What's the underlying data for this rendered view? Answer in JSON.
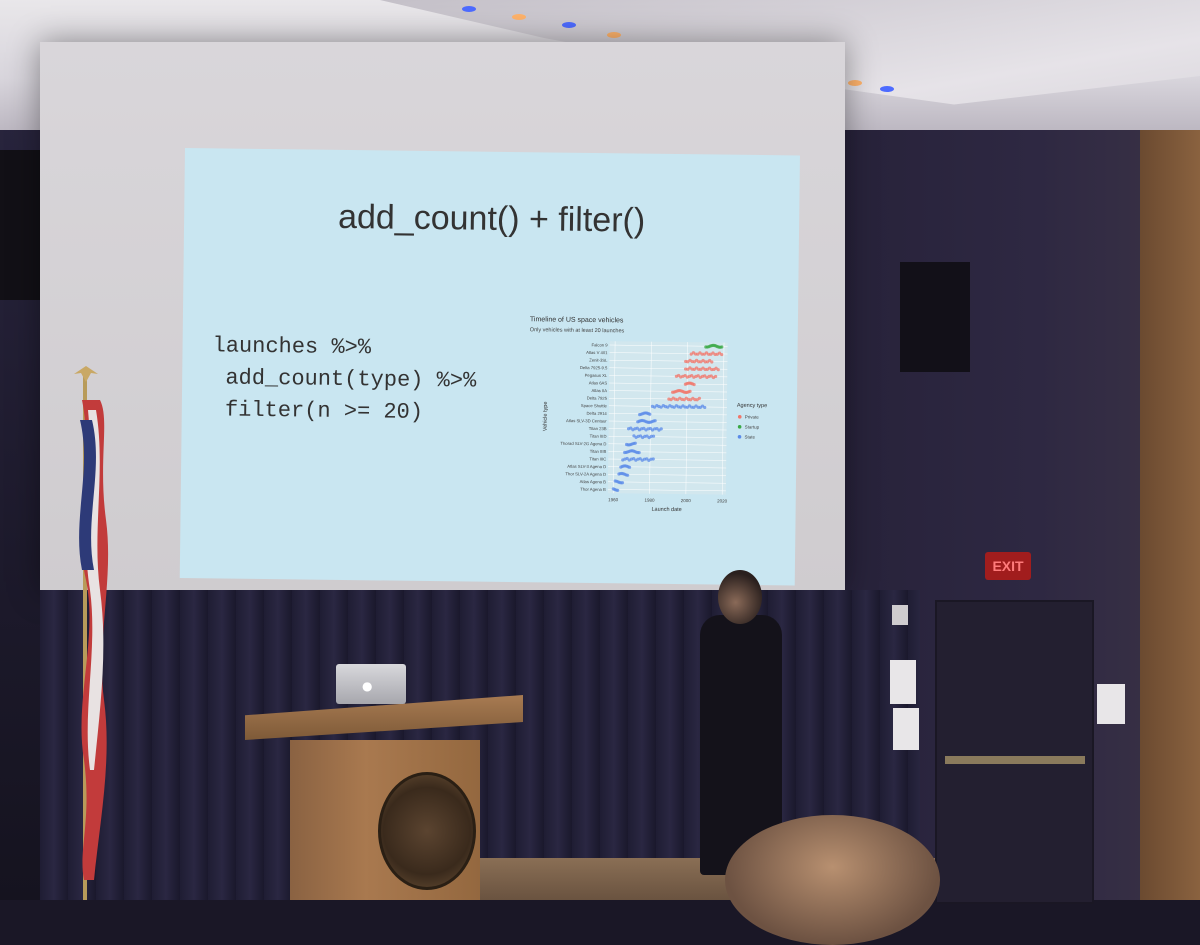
{
  "slide": {
    "title": "add_count() + filter()",
    "code_lines": [
      "launches %>%",
      " add_count(type) %>%",
      " filter(n >= 20)"
    ]
  },
  "chart_data": {
    "type": "scatter",
    "title": "Timeline of US space vehicles",
    "subtitle": "Only vehicles with at least 20 launches",
    "xlabel": "Launch date",
    "ylabel": "Vehicle type",
    "x_ticks": [
      "1960",
      "1980",
      "2000",
      "2020"
    ],
    "xlim": [
      1957,
      2022
    ],
    "categories": [
      "Falcon 9",
      "Atlas V 401",
      "Zenit-3SL",
      "Delta 7925-9.5",
      "Pegasus XL",
      "Atlas 6AS",
      "Atlas IIA",
      "Delta 7925",
      "Space Shuttle",
      "Delta 2914",
      "Atlas SLV-3D Centaur",
      "Titan 23B",
      "Titan IIID",
      "Thorad SLV-2G Agena D",
      "Titan IIIB",
      "Titan IIIC",
      "Atlas SLV-3 Agena D",
      "Thor SLV-2A Agena D",
      "Atlas Agena B",
      "Thor Agena B"
    ],
    "legend": {
      "title": "Agency type",
      "placement": "right",
      "entries": [
        {
          "name": "Private",
          "color": "#f0766a"
        },
        {
          "name": "Startup",
          "color": "#39a845"
        },
        {
          "name": "State",
          "color": "#5b8be8"
        }
      ]
    },
    "series": [
      {
        "name": "Startup",
        "color": "#39a845",
        "ranges": [
          {
            "category": "Falcon 9",
            "from": 2010,
            "to": 2019
          }
        ]
      },
      {
        "name": "Private",
        "color": "#f0766a",
        "ranges": [
          {
            "category": "Atlas V 401",
            "from": 2002,
            "to": 2019
          },
          {
            "category": "Zenit-3SL",
            "from": 1999,
            "to": 2014
          },
          {
            "category": "Delta 7925-9.5",
            "from": 1999,
            "to": 2018
          },
          {
            "category": "Pegasus XL",
            "from": 1994,
            "to": 2016
          },
          {
            "category": "Atlas 6AS",
            "from": 1999,
            "to": 2004
          },
          {
            "category": "Atlas IIA",
            "from": 1992,
            "to": 2002
          },
          {
            "category": "Delta 7925",
            "from": 1990,
            "to": 2008
          }
        ]
      },
      {
        "name": "State",
        "color": "#5b8be8",
        "ranges": [
          {
            "category": "Space Shuttle",
            "from": 1981,
            "to": 2011
          },
          {
            "category": "Delta 2914",
            "from": 1974,
            "to": 1980
          },
          {
            "category": "Atlas SLV-3D Centaur",
            "from": 1973,
            "to": 1983
          },
          {
            "category": "Titan 23B",
            "from": 1968,
            "to": 1987
          },
          {
            "category": "Titan IIID",
            "from": 1971,
            "to": 1982
          },
          {
            "category": "Thorad SLV-2G Agena D",
            "from": 1967,
            "to": 1972
          },
          {
            "category": "Titan IIIB",
            "from": 1966,
            "to": 1974
          },
          {
            "category": "Titan IIIC",
            "from": 1965,
            "to": 1982
          },
          {
            "category": "Atlas SLV-3 Agena D",
            "from": 1964,
            "to": 1969
          },
          {
            "category": "Thor SLV-2A Agena D",
            "from": 1963,
            "to": 1968
          },
          {
            "category": "Atlas Agena B",
            "from": 1961,
            "to": 1965
          },
          {
            "category": "Thor Agena B",
            "from": 1960,
            "to": 1963
          }
        ]
      }
    ]
  },
  "room": {
    "exit_sign": "EXIT"
  }
}
